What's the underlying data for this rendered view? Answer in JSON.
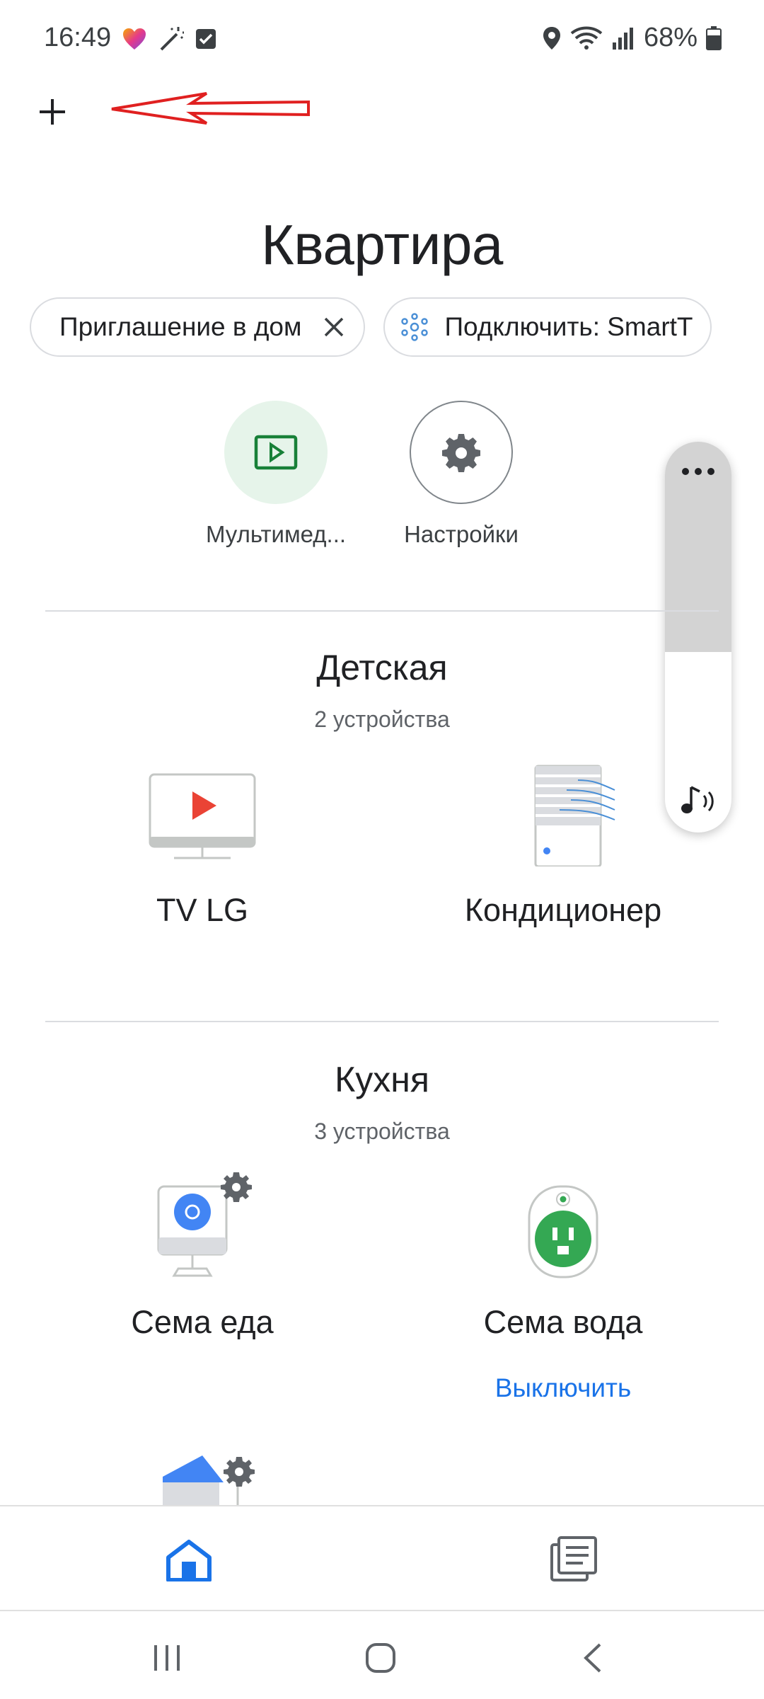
{
  "status": {
    "time": "16:49",
    "battery": "68%"
  },
  "home": {
    "title": "Квартира"
  },
  "chips": {
    "invite": "Приглашение в дом",
    "connect": "Подключить: SmartT"
  },
  "shortcuts": {
    "media": "Мультимед...",
    "settings": "Настройки"
  },
  "rooms": [
    {
      "name": "Детская",
      "count": "2 устройства",
      "devices": [
        {
          "name": "TV LG",
          "icon": "tv-icon"
        },
        {
          "name": "Кондиционер",
          "icon": "air-conditioner-icon"
        }
      ]
    },
    {
      "name": "Кухня",
      "count": "3 устройства",
      "devices": [
        {
          "name": "Сема еда",
          "icon": "camera-icon"
        },
        {
          "name": "Сема вода",
          "icon": "smart-plug-icon",
          "action": "Выключить"
        }
      ]
    }
  ],
  "volume": {
    "level": 0.58
  },
  "colors": {
    "accent": "#1a73e8",
    "media_bg": "#e6f4ea",
    "media_icon": "#188038",
    "plug_green": "#34a853",
    "tv_red": "#ea4335",
    "annotation_red": "#e02020"
  }
}
